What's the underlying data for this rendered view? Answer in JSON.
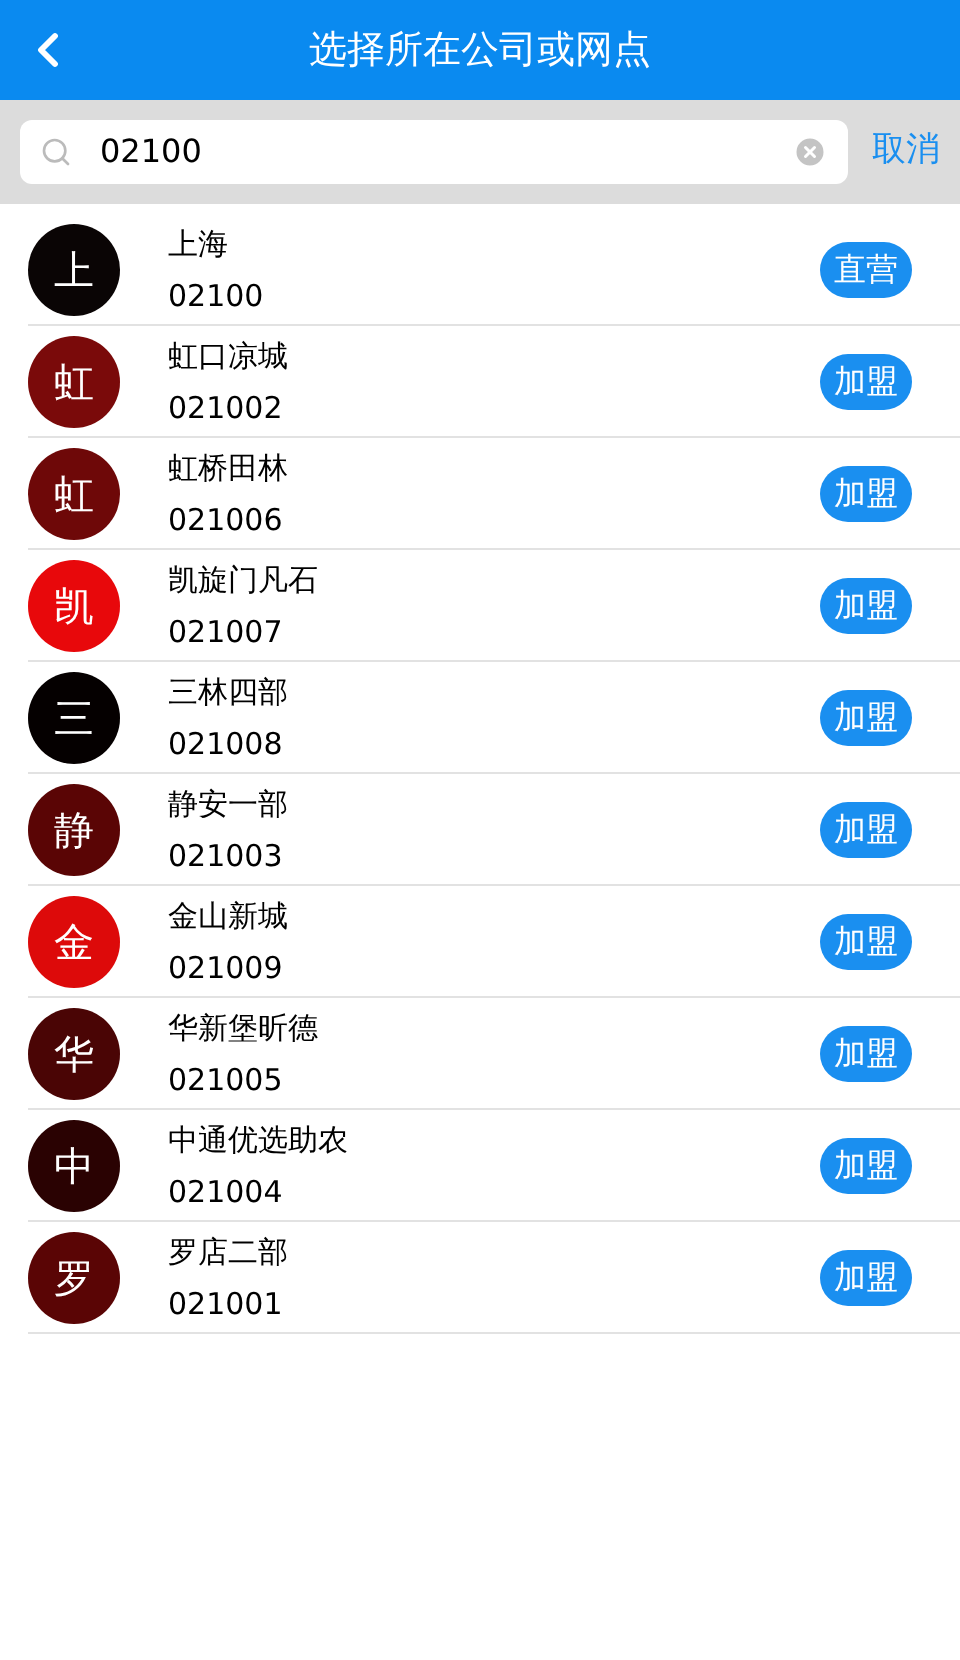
{
  "header": {
    "title": "选择所在公司或网点"
  },
  "search": {
    "value": "02100",
    "cancel": "取消"
  },
  "items": [
    {
      "avatar": "上",
      "color": "#0a0505",
      "name": "上海",
      "code": "02100",
      "tag": "直营"
    },
    {
      "avatar": "虹",
      "color": "#7a0a0a",
      "name": "虹口凉城",
      "code": "021002",
      "tag": "加盟"
    },
    {
      "avatar": "虹",
      "color": "#6e0808",
      "name": "虹桥田林",
      "code": "021006",
      "tag": "加盟"
    },
    {
      "avatar": "凯",
      "color": "#e8080b",
      "name": "凯旋门凡石",
      "code": "021007",
      "tag": "加盟"
    },
    {
      "avatar": "三",
      "color": "#050000",
      "name": "三林四部",
      "code": "021008",
      "tag": "加盟"
    },
    {
      "avatar": "静",
      "color": "#5a0505",
      "name": "静安一部",
      "code": "021003",
      "tag": "加盟"
    },
    {
      "avatar": "金",
      "color": "#dd0a0a",
      "name": "金山新城",
      "code": "021009",
      "tag": "加盟"
    },
    {
      "avatar": "华",
      "color": "#4a0505",
      "name": "华新堡昕德",
      "code": "021005",
      "tag": "加盟"
    },
    {
      "avatar": "中",
      "color": "#2a0202",
      "name": "中通优选助农",
      "code": "021004",
      "tag": "加盟"
    },
    {
      "avatar": "罗",
      "color": "#5a0505",
      "name": "罗店二部",
      "code": "021001",
      "tag": "加盟"
    }
  ]
}
